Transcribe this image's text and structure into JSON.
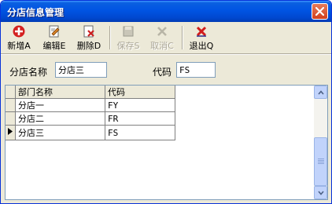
{
  "window": {
    "title": "分店信息管理"
  },
  "toolbar": {
    "buttons": [
      {
        "label": "新增A",
        "icon": "plus-icon",
        "enabled": true
      },
      {
        "label": "编辑E",
        "icon": "edit-icon",
        "enabled": true
      },
      {
        "label": "删除D",
        "icon": "delete-icon",
        "enabled": true
      },
      {
        "label": "保存S",
        "icon": "save-icon",
        "enabled": false
      },
      {
        "label": "取消C",
        "icon": "cancel-icon",
        "enabled": false
      },
      {
        "label": "退出Q",
        "icon": "exit-icon",
        "enabled": true
      }
    ]
  },
  "form": {
    "name_label": "分店名称",
    "name_value": "分店三",
    "code_label": "代码",
    "code_value": "FS"
  },
  "grid": {
    "columns": [
      "部门名称",
      "代码"
    ],
    "rows": [
      {
        "name": "分店一",
        "code": "FY",
        "current": false
      },
      {
        "name": "分店二",
        "code": "FR",
        "current": false
      },
      {
        "name": "分店三",
        "code": "FS",
        "current": true
      }
    ]
  },
  "colors": {
    "titlebar": "#0054e3",
    "window_bg": "#ece9d8",
    "close_button": "#d2401d",
    "disabled_text": "#aca899"
  }
}
